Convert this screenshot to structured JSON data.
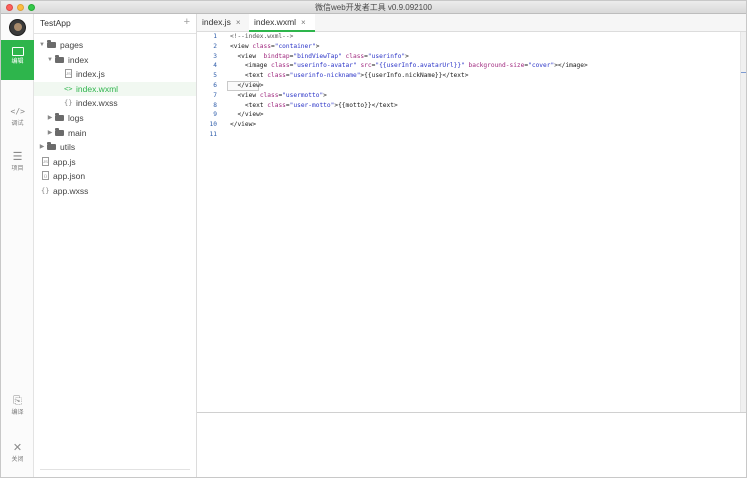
{
  "window": {
    "title": "微信web开发者工具 v0.9.092100"
  },
  "activity_bar": {
    "items": [
      {
        "label": "编辑",
        "icon": "edit-icon"
      },
      {
        "label": "调试",
        "icon": "code-brackets-icon"
      },
      {
        "label": "项目",
        "icon": "list-icon"
      },
      {
        "label": "编译",
        "icon": "compile-icon"
      },
      {
        "label": "关闭",
        "icon": "close-icon"
      }
    ]
  },
  "explorer": {
    "project": "TestApp",
    "add_symbol": "+",
    "tree": [
      {
        "name": "pages",
        "kind": "folder",
        "expanded": true
      },
      {
        "name": "index",
        "kind": "folder",
        "expanded": true
      },
      {
        "name": "index.js",
        "kind": "js"
      },
      {
        "name": "index.wxml",
        "kind": "wxml",
        "selected": true
      },
      {
        "name": "index.wxss",
        "kind": "wxss"
      },
      {
        "name": "logs",
        "kind": "folder",
        "expanded": false
      },
      {
        "name": "main",
        "kind": "folder",
        "expanded": false
      },
      {
        "name": "utils",
        "kind": "folder",
        "expanded": false
      },
      {
        "name": "app.js",
        "kind": "js"
      },
      {
        "name": "app.json",
        "kind": "json"
      },
      {
        "name": "app.wxss",
        "kind": "wxss"
      }
    ]
  },
  "tabs": [
    {
      "label": "index.js",
      "close": "×",
      "active": false
    },
    {
      "label": "index.wxml",
      "close": "×",
      "active": true
    }
  ],
  "editor": {
    "line_numbers": [
      "1",
      "2",
      "3",
      "4",
      "5",
      "6",
      "7",
      "8",
      "9",
      "10",
      "11"
    ],
    "lines": [
      "<!--index.wxml-->",
      "<view class=\"container\">",
      "  <view  bindtap=\"bindViewTap\" class=\"userinfo\">",
      "    <image class=\"userinfo-avatar\" src=\"{{userInfo.avatarUrl}}\" background-size=\"cover\"></image>",
      "    <text class=\"userinfo-nickname\">{{userInfo.nickName}}</text>",
      "  </view>",
      "  <view class=\"usermotto\">",
      "    <text class=\"user-motto\">{{motto}}</text>",
      "  </view>",
      "</view>",
      ""
    ],
    "cursor_line": 6
  },
  "colors": {
    "accent": "#2eb54c",
    "attr": "#a0297f",
    "string": "#2a33c7"
  }
}
